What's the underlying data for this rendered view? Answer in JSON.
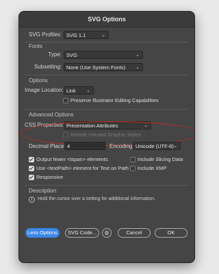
{
  "window": {
    "title": "SVG Options"
  },
  "svg_profiles": {
    "label": "SVG Profiles:",
    "value": "SVG 1.1"
  },
  "fonts": {
    "section": "Fonts",
    "type_label": "Type:",
    "type_value": "SVG",
    "subsetting_label": "Subsetting:",
    "subsetting_value": "None (Use System Fonts)"
  },
  "options": {
    "section": "Options",
    "image_location_label": "Image Location:",
    "image_location_value": "Link",
    "preserve_label": "Preserve Illustrator Editing Capabilities"
  },
  "advanced": {
    "section": "Advanced Options",
    "css_label": "CSS Properties:",
    "css_value": "Presentation Attributes",
    "unused_styles_label": "Include Unused Graphic Styles",
    "decimal_label": "Decimal Places:",
    "decimal_value": "4",
    "encoding_label": "Encoding:",
    "encoding_value": "Unicode (UTF-8)",
    "output_fewer_label": "Output fewer <tspan> elements",
    "include_slicing_label": "Include Slicing Data",
    "textpath_label": "Use <textPath> element for Text on Path",
    "include_xmp_label": "Include XMP",
    "responsive_label": "Responsive"
  },
  "description": {
    "section": "Description",
    "text": "Hold the cursor over a setting for additional information."
  },
  "buttons": {
    "less_options": "Less Options",
    "svg_code": "SVG Code...",
    "cancel": "Cancel",
    "ok": "OK"
  },
  "colors": {
    "accent": "#3b86e8",
    "annotation": "#c62b1f",
    "panel": "#454545"
  }
}
